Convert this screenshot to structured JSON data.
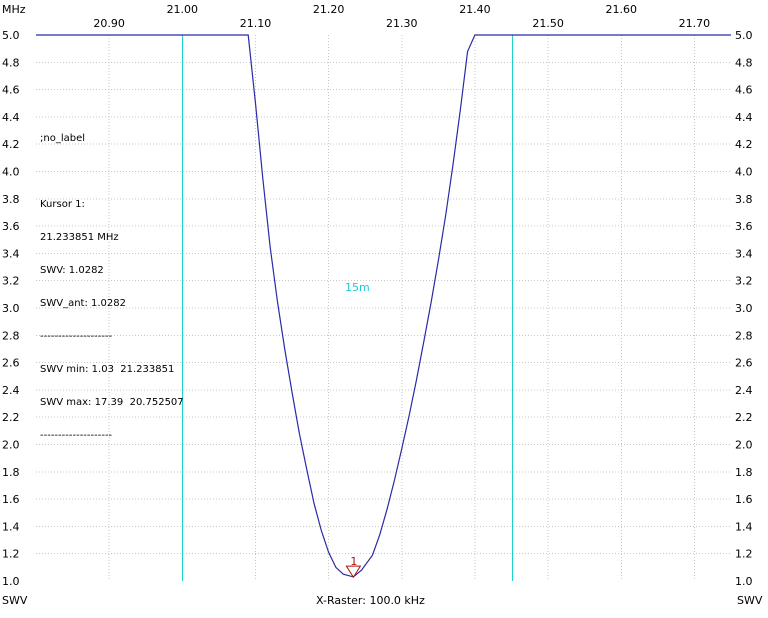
{
  "labels": {
    "unit_top_left": "MHz",
    "unit_bottom_left": "SWV",
    "unit_bottom_right": "SWV",
    "x_raster": "X-Raster: 100.0 kHz"
  },
  "info_block": {
    "no_label": ";no_label",
    "cursor_title": "Kursor 1:",
    "cursor_freq": "21.233851 MHz",
    "cursor_swv": "SWV: 1.0282",
    "cursor_swv_ant": "SWV_ant: 1.0282",
    "separator1": "--------------------",
    "swv_min": "SWV min: 1.03  21.233851",
    "swv_max": "SWV max: 17.39  20.752507",
    "separator2": "--------------------"
  },
  "band_label": "15m",
  "marker_label": "1",
  "colors": {
    "trace": "#2a2aa8",
    "band_edge": "#20d0d0",
    "band_label": "#20c8d8",
    "grid": "#c8c8c8",
    "marker": "#b01010"
  },
  "chart_data": {
    "type": "line",
    "xlabel": "",
    "ylabel": "SWV",
    "xlim": [
      20.8,
      21.75
    ],
    "ylim": [
      1.0,
      5.0
    ],
    "x_ticks": [
      "20.90",
      "21.00",
      "21.10",
      "21.20",
      "21.30",
      "21.40",
      "21.50",
      "21.60",
      "21.70"
    ],
    "y_ticks": [
      "5.0",
      "4.8",
      "4.6",
      "4.4",
      "4.2",
      "4.0",
      "3.8",
      "3.6",
      "3.4",
      "3.2",
      "3.0",
      "2.8",
      "2.6",
      "2.4",
      "2.2",
      "2.0",
      "1.8",
      "1.6",
      "1.4",
      "1.2",
      "1.0"
    ],
    "band_edges": [
      21.0,
      21.45
    ],
    "cursor": {
      "x": 21.233851,
      "y": 1.0282
    },
    "series": [
      {
        "x": [
          20.8,
          21.0,
          21.09,
          21.1,
          21.11,
          21.12,
          21.13,
          21.14,
          21.15,
          21.16,
          21.17,
          21.18,
          21.19,
          21.2,
          21.21,
          21.22,
          21.233851,
          21.245,
          21.26,
          21.27,
          21.28,
          21.29,
          21.3,
          21.31,
          21.32,
          21.33,
          21.34,
          21.35,
          21.36,
          21.37,
          21.38,
          21.39,
          21.4,
          21.5,
          21.75
        ],
        "y": [
          5.0,
          5.0,
          5.0,
          4.5,
          3.95,
          3.45,
          3.05,
          2.7,
          2.38,
          2.08,
          1.82,
          1.57,
          1.37,
          1.21,
          1.1,
          1.05,
          1.03,
          1.08,
          1.19,
          1.34,
          1.53,
          1.74,
          1.97,
          2.21,
          2.47,
          2.75,
          3.04,
          3.35,
          3.68,
          4.05,
          4.45,
          4.88,
          5.0,
          5.0,
          5.0
        ]
      }
    ]
  }
}
